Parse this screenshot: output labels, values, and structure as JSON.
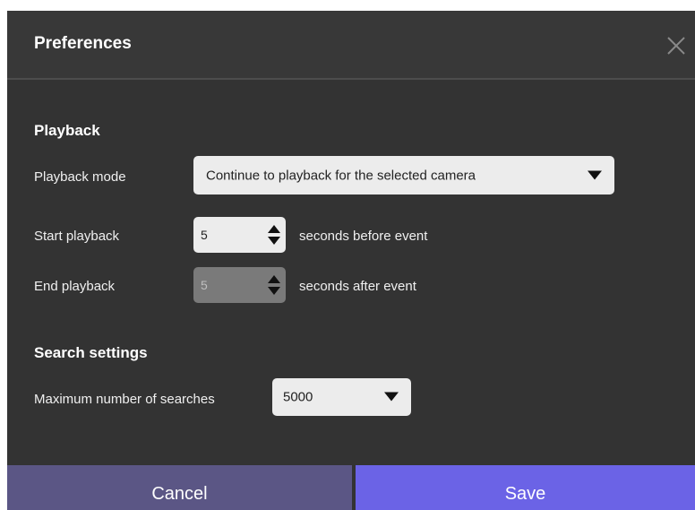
{
  "dialog": {
    "title": "Preferences",
    "close_icon": "close-icon"
  },
  "playback": {
    "section_title": "Playback",
    "mode_label": "Playback mode",
    "mode_value": "Continue to playback for the selected camera",
    "start_label": "Start playback",
    "start_value": "5",
    "start_suffix": "seconds before event",
    "end_label": "End playback",
    "end_value": "5",
    "end_suffix": "seconds after event",
    "end_enabled": false
  },
  "search": {
    "section_title": "Search settings",
    "max_label": "Maximum number of searches",
    "max_value": "5000"
  },
  "footer": {
    "cancel_label": "Cancel",
    "save_label": "Save"
  },
  "colors": {
    "background": "#333333",
    "cancel_button": "#5b5685",
    "save_button": "#6b63e6"
  }
}
